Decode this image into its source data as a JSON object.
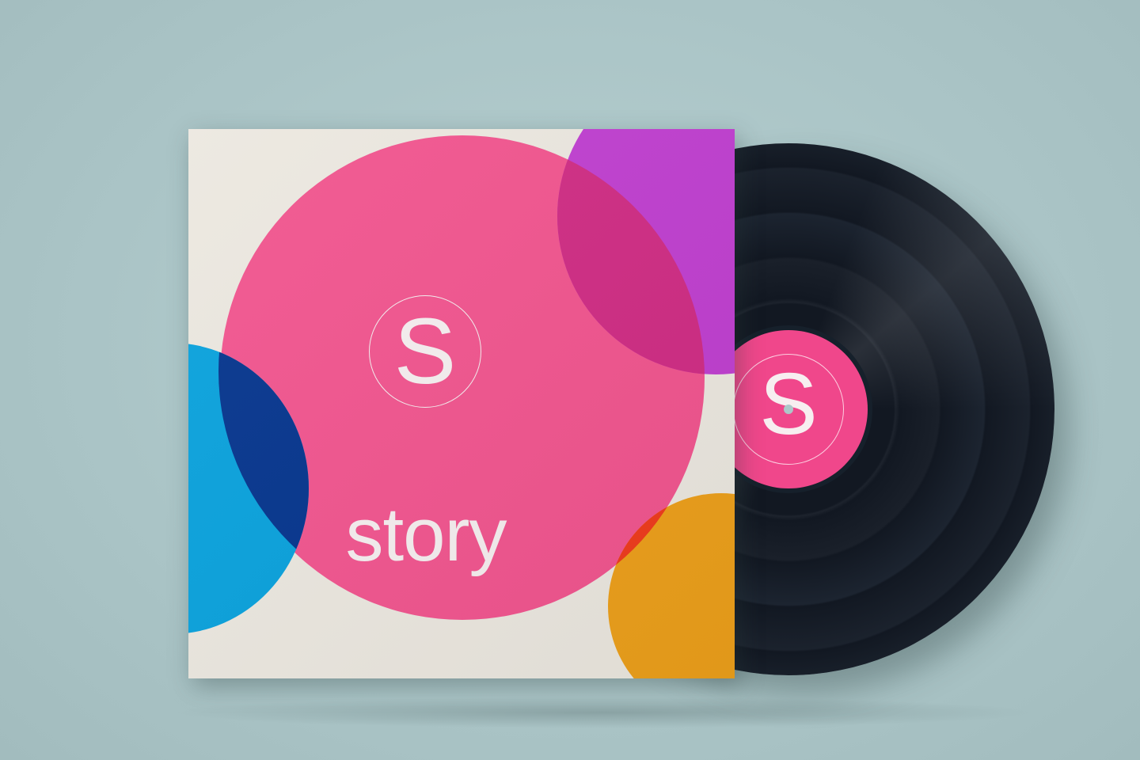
{
  "album": {
    "logo_letter": "S",
    "title": "story"
  },
  "vinyl": {
    "label_letter": "S"
  },
  "colors": {
    "background": "#adc7c9",
    "sleeve": "#ece8e0",
    "pink": "#f2558f",
    "purple": "#c03fd0",
    "magenta_overlap": "#d02c84",
    "blue": "#09a2dd",
    "navy_overlap": "#05358e",
    "orange": "#eda01b",
    "red_overlap": "#f03b1d",
    "vinyl": "#121822",
    "label": "#f0478b"
  }
}
